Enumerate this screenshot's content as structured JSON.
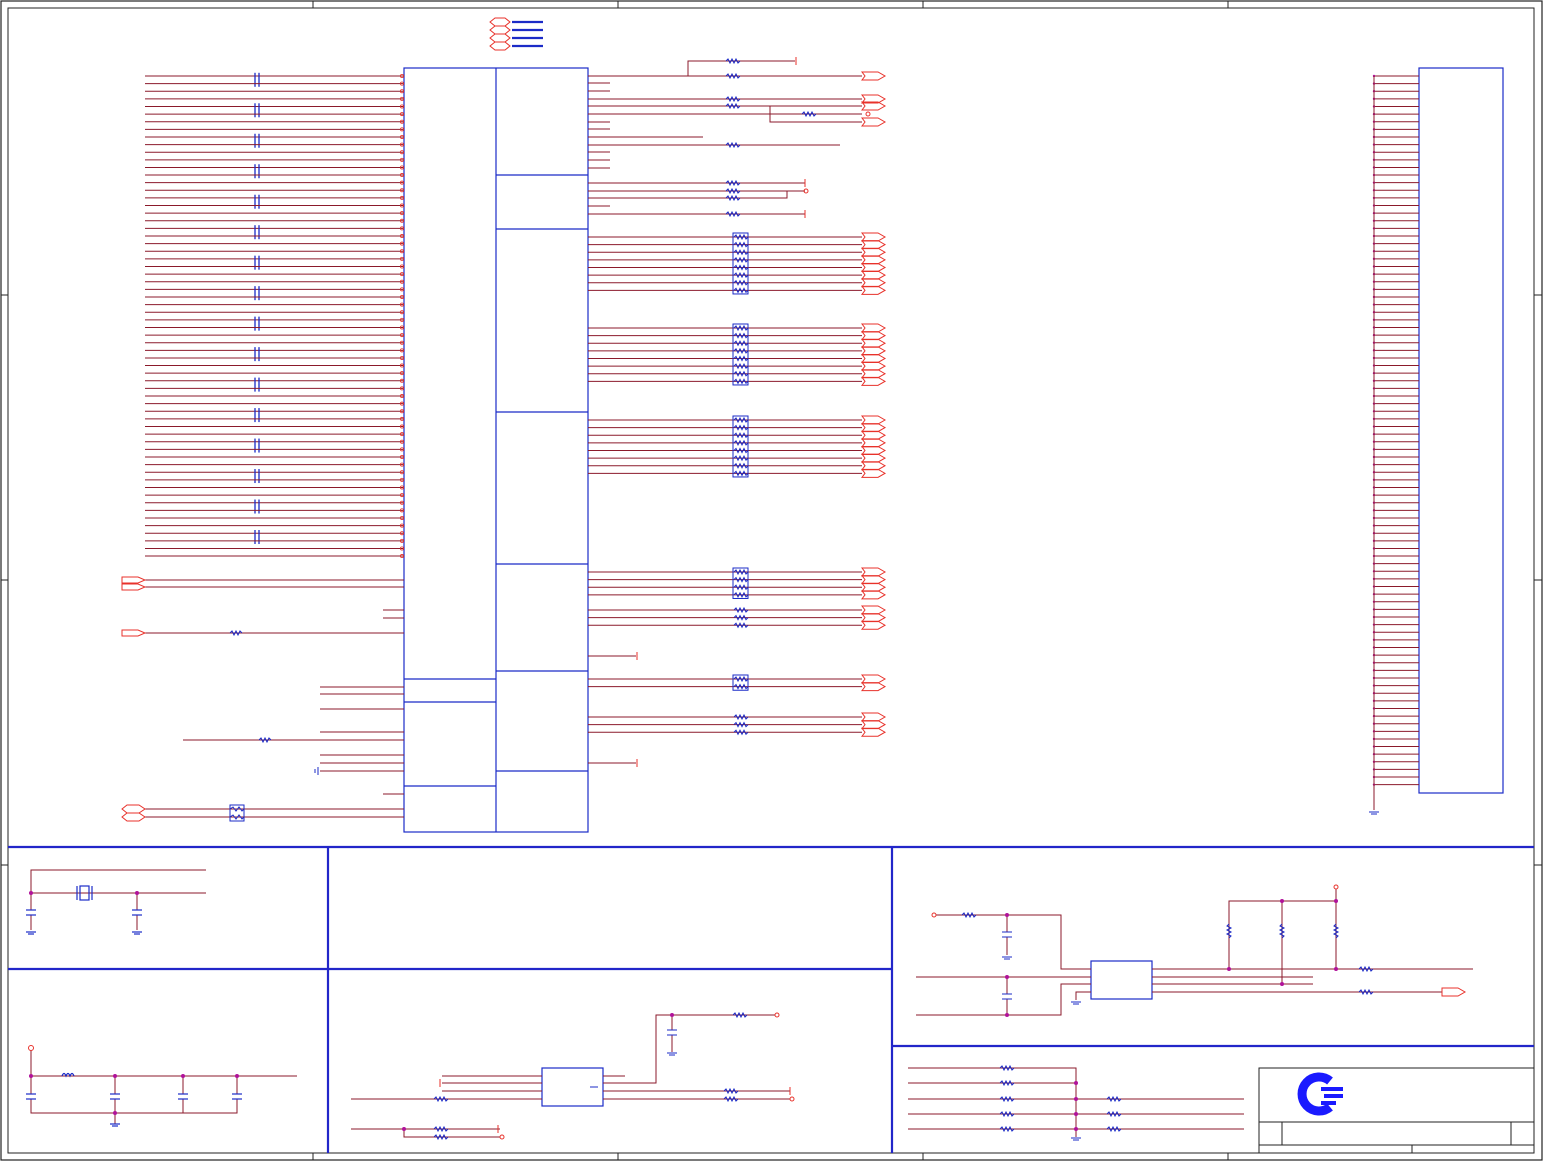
{
  "diagram": {
    "type": "electrical-schematic",
    "printed_text": [],
    "colors": {
      "wire": "#8b1a2b",
      "port": "#e8322b",
      "component": "#1b2bc7",
      "frame": "#2226c9",
      "junction": "#b0129a",
      "border": "#222222"
    },
    "logo_icon": "company-logo-c-icon",
    "sections": [
      "main-schematic",
      "crystal-oscillator-block",
      "power-filter-block",
      "notes-block",
      "regulator-block",
      "reset-circuit-block",
      "pullup-resistor-block",
      "title-block"
    ]
  }
}
